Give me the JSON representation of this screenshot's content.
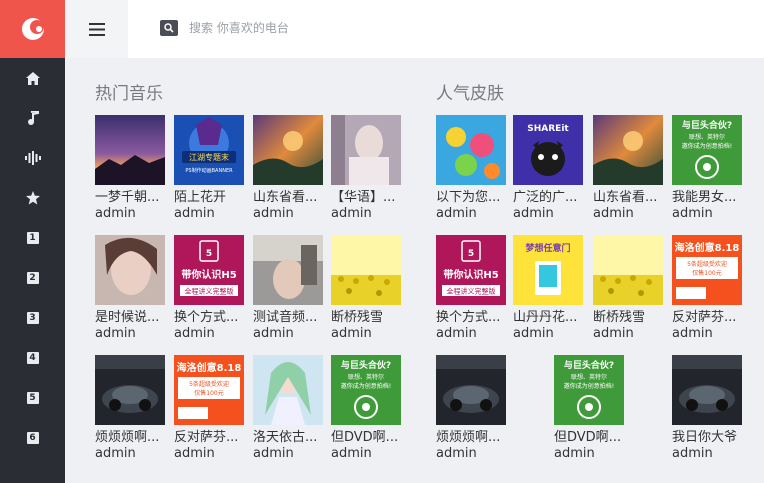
{
  "search": {
    "placeholder": "搜索 你喜欢的电台"
  },
  "nav": {
    "items": [
      {
        "icon": "home-icon"
      },
      {
        "icon": "music-note-icon"
      },
      {
        "icon": "audio-wave-icon"
      },
      {
        "icon": "star-icon"
      },
      {
        "icon": "channel-1-icon",
        "label": "1"
      },
      {
        "icon": "channel-2-icon",
        "label": "2"
      },
      {
        "icon": "channel-3-icon",
        "label": "3"
      },
      {
        "icon": "channel-4-icon",
        "label": "4"
      },
      {
        "icon": "channel-5-icon",
        "label": "5"
      },
      {
        "icon": "channel-6-icon",
        "label": "6"
      }
    ]
  },
  "hot_music": {
    "title": "热门音乐",
    "cards": [
      {
        "title": "一梦千朝...",
        "author": "admin",
        "art": "sunset"
      },
      {
        "title": "陌上花开",
        "author": "admin",
        "art": "banner-blue"
      },
      {
        "title": "山东省看...",
        "author": "admin",
        "art": "fantasy"
      },
      {
        "title": "【华语】...",
        "author": "admin",
        "art": "photo-pale"
      },
      {
        "title": "是时候说...",
        "author": "admin",
        "art": "photo-face"
      },
      {
        "title": "换个方式...",
        "author": "admin",
        "art": "h5-purple"
      },
      {
        "title": "测试音频...",
        "author": "admin",
        "art": "photo-room"
      },
      {
        "title": "断桥残雪",
        "author": "admin",
        "art": "flowers"
      },
      {
        "title": "烦烦烦啊...",
        "author": "admin",
        "art": "dark-car"
      },
      {
        "title": "反对萨芬...",
        "author": "admin",
        "art": "orange-ad"
      },
      {
        "title": "洛天依古...",
        "author": "admin",
        "art": "anime"
      },
      {
        "title": "但DVD啊...",
        "author": "admin",
        "art": "green-ad"
      }
    ]
  },
  "popular_skins": {
    "title": "人气皮肤",
    "cards": [
      {
        "title": "以下为您...",
        "author": "admin",
        "art": "colorful"
      },
      {
        "title": "广泛的广...",
        "author": "admin",
        "art": "shareit"
      },
      {
        "title": "山东省看...",
        "author": "admin",
        "art": "fantasy"
      },
      {
        "title": "我能男女...",
        "author": "admin",
        "art": "green-ad"
      },
      {
        "title": "换个方式...",
        "author": "admin",
        "art": "h5-purple"
      },
      {
        "title": "山丹丹花...",
        "author": "admin",
        "art": "yellow-dream"
      },
      {
        "title": "断桥残雪",
        "author": "admin",
        "art": "flowers"
      },
      {
        "title": "反对萨芬...",
        "author": "admin",
        "art": "orange-ad"
      },
      {
        "title": "烦烦烦啊...",
        "author": "admin",
        "art": "dark-car"
      },
      {
        "title": "但DVD啊...",
        "author": "admin",
        "art": "green-ad"
      },
      {
        "title": "我日你大爷",
        "author": "admin",
        "art": "dark-car"
      }
    ]
  },
  "art_text": {
    "banner": "江湖专题末",
    "banner_sub": "PS制作动画BANNER",
    "h5": "带你认识H5",
    "h5_sub": "全程讲义完整版",
    "orange_title": "海洛创意8.18",
    "orange_line1": "5条超级受欢迎",
    "orange_line2": "仅售100元",
    "green_title": "与巨头合伙?",
    "green_line1": "联想、英特尔",
    "green_line2": "邀你成为创意拍档!",
    "shareit": "SHAREit",
    "yellow_title": "梦想任意门"
  },
  "colors": {
    "sidebar": "#2a2d34",
    "logo": "#f0554c",
    "header": "#ffffff",
    "background": "#eef0f3"
  }
}
